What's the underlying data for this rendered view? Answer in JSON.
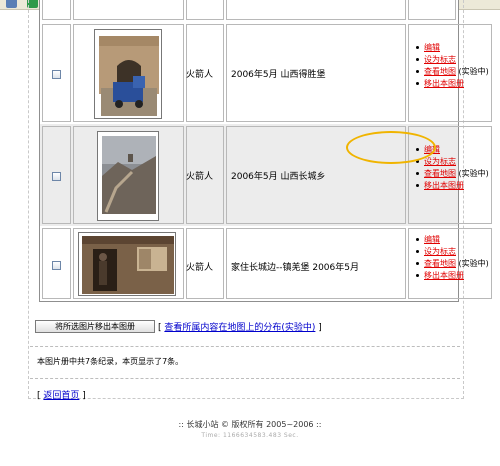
{
  "toolbar": {
    "icons": [
      {
        "name": "app-icon-1",
        "color": "#5a7fb5"
      },
      {
        "name": "app-icon-2",
        "color": "#2f9a4a"
      },
      {
        "name": "app-icon-3",
        "color": "#3a6ec4"
      },
      {
        "name": "tools-icon",
        "color": "#c79a28"
      },
      {
        "name": "favorites-star-icon",
        "color": "#f2c21a"
      },
      {
        "name": "history-icon",
        "color": "#4a9a6a"
      },
      {
        "name": "mail-icon",
        "color": "#6b8fc8"
      },
      {
        "name": "print-icon",
        "color": "#8a8a8a"
      },
      {
        "name": "edit-icon",
        "color": "#e8c65a"
      },
      {
        "name": "discuss-icon",
        "color": "#7a8fb8"
      },
      {
        "name": "messenger-icon",
        "color": "#4a6fa0"
      }
    ]
  },
  "rows": [
    {
      "author": "火箭人",
      "description": "2006年5月 山西得胜堡",
      "actions": [
        {
          "label": "编辑"
        },
        {
          "label": "设为标志"
        },
        {
          "label": "查看地图",
          "note": " (实验中)"
        },
        {
          "label": "移出本图册"
        }
      ]
    },
    {
      "author": "火箭人",
      "description": "2006年5月 山西长城乡",
      "actions": [
        {
          "label": "编辑"
        },
        {
          "label": "设为标志"
        },
        {
          "label": "查看地图",
          "note": " (实验中)"
        },
        {
          "label": "移出本图册"
        }
      ]
    },
    {
      "author": "火箭人",
      "description": "家住长城边--镇羌堡 2006年5月",
      "actions": [
        {
          "label": "编辑"
        },
        {
          "label": "设为标志"
        },
        {
          "label": "查看地图",
          "note": " (实验中)"
        },
        {
          "label": "移出本图册"
        }
      ]
    }
  ],
  "bottom": {
    "move_button": "将所选图片移出本图册",
    "distribution_prefix": "[ ",
    "distribution_link": "查看所属内容在地图上的分布(实验中)",
    "distribution_suffix": " ]",
    "summary": "本图片册中共7条纪录，本页显示了7条。",
    "back_prefix": "[ ",
    "back_link": "返回首页",
    "back_suffix": " ]"
  },
  "footer": {
    "line1": ":: 长城小站 © 版权所有 2005~2006 ::",
    "line2": "Time: 1166634583.483 Sec."
  }
}
